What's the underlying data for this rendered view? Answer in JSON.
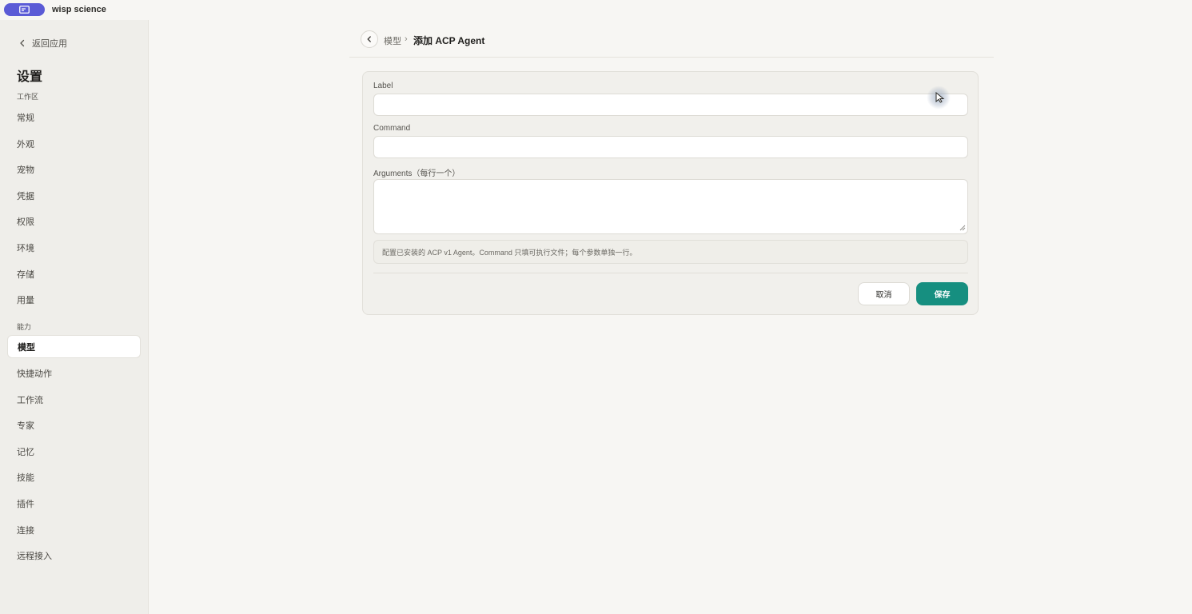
{
  "app": {
    "name": "wisp science",
    "icon": "window-icon",
    "accent": "#5b5bd6"
  },
  "sidebar": {
    "back_label": "返回应用",
    "title": "设置",
    "sections": [
      {
        "label": "工作区",
        "items": [
          "常规",
          "外观",
          "宠物",
          "凭据",
          "权限",
          "环境",
          "存储",
          "用量"
        ]
      },
      {
        "label": "能力",
        "items": [
          "模型",
          "快捷动作",
          "工作流",
          "专家",
          "记忆",
          "技能",
          "插件",
          "连接",
          "远程接入"
        ]
      }
    ],
    "active_item": "模型"
  },
  "breadcrumb": {
    "parent": "模型",
    "separator": "›",
    "current": "添加 ACP Agent"
  },
  "form": {
    "label_field": {
      "label": "Label",
      "value": "",
      "placeholder": ""
    },
    "command_field": {
      "label": "Command",
      "value": "",
      "placeholder": ""
    },
    "arguments_field": {
      "label": "Arguments（每行一个）",
      "value": "",
      "placeholder": ""
    },
    "hint": "配置已安装的 ACP v1 Agent。Command 只填可执行文件；每个参数单独一行。",
    "cancel_label": "取消",
    "save_label": "保存",
    "save_color": "#168f80"
  }
}
